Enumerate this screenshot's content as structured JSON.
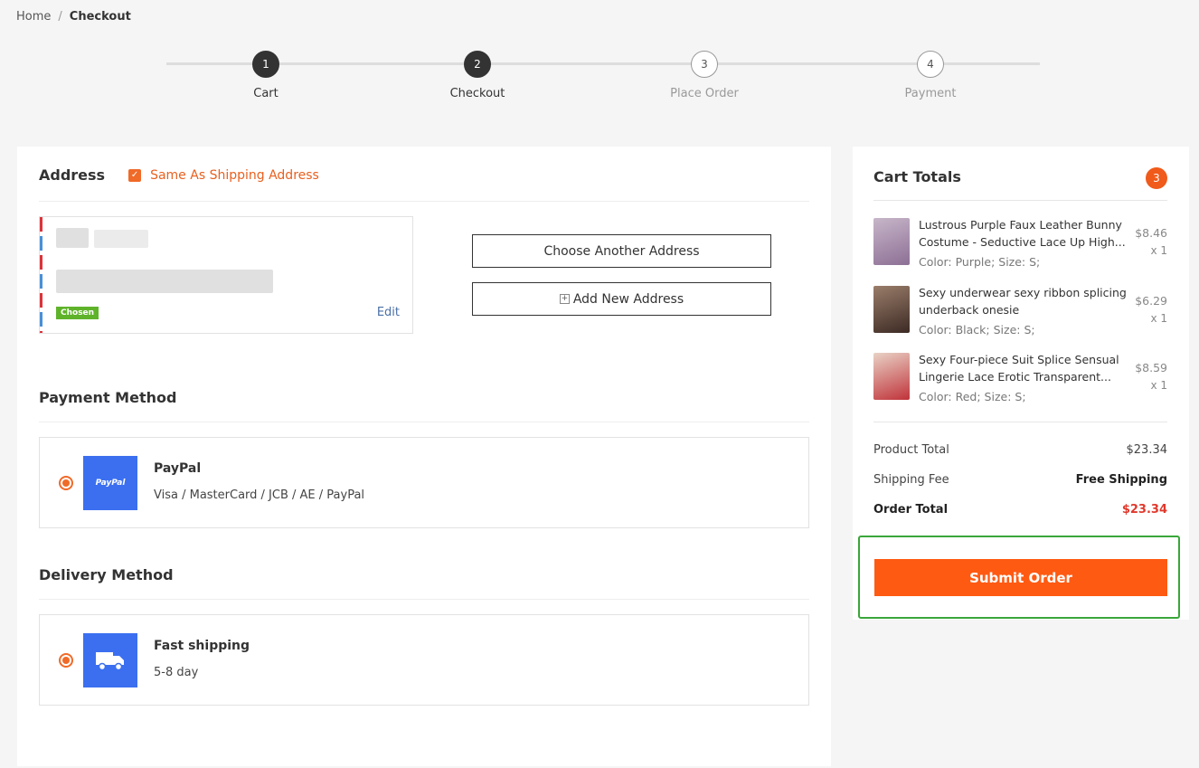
{
  "breadcrumb": {
    "home": "Home",
    "separator": "/",
    "current": "Checkout"
  },
  "steps": [
    {
      "number": "1",
      "label": "Cart",
      "done": true
    },
    {
      "number": "2",
      "label": "Checkout",
      "done": true
    },
    {
      "number": "3",
      "label": "Place Order",
      "done": false
    },
    {
      "number": "4",
      "label": "Payment",
      "done": false
    }
  ],
  "address": {
    "title": "Address",
    "same_as_shipping": "Same As Shipping Address",
    "checkbox_mark": "✓",
    "chosen_badge": "Chosen",
    "edit_label": "Edit",
    "choose_another": "Choose Another Address",
    "add_new": "Add New Address",
    "add_new_icon": "+"
  },
  "payment": {
    "title": "Payment Method",
    "name": "PayPal",
    "description": "Visa / MasterCard / JCB / AE / PayPal",
    "icon_text": "PayPal"
  },
  "delivery": {
    "title": "Delivery Method",
    "name": "Fast shipping",
    "description": "5-8 day"
  },
  "cart": {
    "title": "Cart Totals",
    "count": "3",
    "items": [
      {
        "name": "Lustrous Purple Faux Leather Bunny Costume - Seductive Lace Up High...",
        "options": "Color: Purple; Size: S;",
        "price": "$8.46",
        "qty": "x 1",
        "thumb_color": "#b49ab8"
      },
      {
        "name": "Sexy underwear sexy ribbon splicing underback onesie",
        "options": "Color: Black; Size: S;",
        "price": "$6.29",
        "qty": "x 1",
        "thumb_color": "#6b5548"
      },
      {
        "name": "Sexy Four-piece Suit Splice Sensual Lingerie Lace Erotic Transparent...",
        "options": "Color: Red; Size: S;",
        "price": "$8.59",
        "qty": "x 1",
        "thumb_color": "#c8464a"
      }
    ],
    "product_total_label": "Product Total",
    "product_total": "$23.34",
    "shipping_label": "Shipping Fee",
    "shipping_value": "Free Shipping",
    "order_total_label": "Order Total",
    "order_total": "$23.34",
    "submit": "Submit Order"
  },
  "colors": {
    "accent": "#ff5a12",
    "highlight": "#3aa63a",
    "payment_blue": "#3b6ff0"
  }
}
